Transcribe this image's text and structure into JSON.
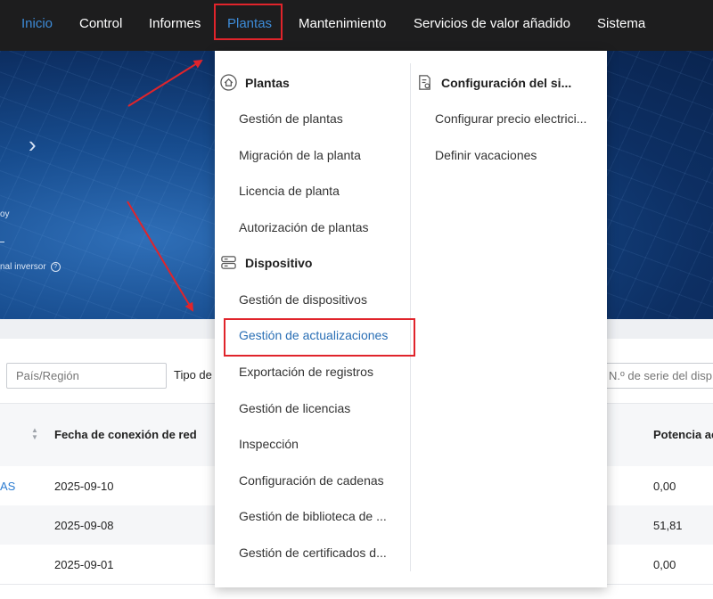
{
  "nav": {
    "items": [
      {
        "label": "Inicio"
      },
      {
        "label": "Control"
      },
      {
        "label": "Informes"
      },
      {
        "label": "Plantas"
      },
      {
        "label": "Mantenimiento"
      },
      {
        "label": "Servicios de valor añadido"
      },
      {
        "label": "Sistema"
      }
    ],
    "active": "Inicio",
    "accent_color": "#3d8bd8"
  },
  "hero": {
    "text_1": "oy",
    "text_2": "nal inversor"
  },
  "filters": {
    "country_placeholder": "País/Región",
    "type_label": "Tipo de",
    "serial_placeholder": "N.º de serie del disp"
  },
  "table": {
    "columns": [
      "Fecha de conexión de red",
      "Potencia ac"
    ],
    "rows": [
      {
        "name": "AS",
        "date": "2025-09-10",
        "power": "0,00"
      },
      {
        "name": "",
        "date": "2025-09-08",
        "power": "51,81"
      },
      {
        "name": "",
        "date": "2025-09-01",
        "power": "0,00"
      }
    ]
  },
  "menu": {
    "plantas_group": {
      "title": "Plantas",
      "icon": "home-icon",
      "items": [
        "Gestión de plantas",
        "Migración de la planta",
        "Licencia de planta",
        "Autorización de plantas"
      ]
    },
    "dispositivo_group": {
      "title": "Dispositivo",
      "icon": "server-icon",
      "items": [
        "Gestión de dispositivos",
        "Gestión de actualizaciones",
        "Exportación de registros",
        "Gestión de licencias",
        "Inspección",
        "Configuración de cadenas",
        "Gestión de biblioteca de ...",
        "Gestión de certificados d..."
      ]
    },
    "config_group": {
      "title": "Configuración del si...",
      "icon": "settings-document-icon",
      "items": [
        "Configurar precio electrici...",
        "Definir vacaciones"
      ]
    },
    "selected_item": "Gestión de actualizaciones"
  },
  "annotation_color": "#e0242b"
}
